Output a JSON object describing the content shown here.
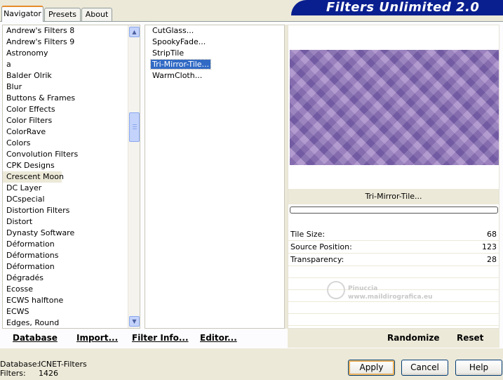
{
  "tabs": [
    "Navigator",
    "Presets",
    "About"
  ],
  "app_title": "Filters Unlimited 2.0",
  "categories": [
    "Andrew's Filters 8",
    "Andrew's Filters 9",
    "Astronomy",
    "a",
    "Balder Olrik",
    "Blur",
    "Buttons & Frames",
    "Color Effects",
    "Color Filters",
    "ColorRave",
    "Colors",
    "Convolution Filters",
    "CPK Designs",
    "Crescent Moon",
    "DC Layer",
    "DCspecial",
    "Distortion Filters",
    "Distort",
    "Dynasty Software",
    "Déformation",
    "Déformations",
    "Déformation",
    "Dégradés",
    "Ecosse",
    "ECWS halftone",
    "ECWS",
    "Edges, Round"
  ],
  "selected_category": "Crescent Moon",
  "filters": [
    "CutGlass...",
    "SpookyFade...",
    "StripTile",
    "Tri-Mirror-Tile...",
    "WarmCloth..."
  ],
  "selected_filter": "Tri-Mirror-Tile...",
  "preview_filter_name": "Tri-Mirror-Tile...",
  "params": [
    {
      "label": "Tile Size:",
      "value": "68"
    },
    {
      "label": "Source Position:",
      "value": "123"
    },
    {
      "label": "Transparency:",
      "value": "28"
    }
  ],
  "watermark": {
    "line1": "Pinuccia",
    "line2": "www.maildirografica.eu"
  },
  "toolbar": {
    "database": "Database",
    "import": "Import...",
    "filter_info": "Filter Info...",
    "editor": "Editor...",
    "randomize": "Randomize",
    "reset": "Reset"
  },
  "status": {
    "database_label": "Database:",
    "database_value": "ICNET-Filters",
    "filters_label": "Filters:",
    "filters_value": "1426"
  },
  "buttons": {
    "apply": "Apply",
    "cancel": "Cancel",
    "help": "Help"
  }
}
